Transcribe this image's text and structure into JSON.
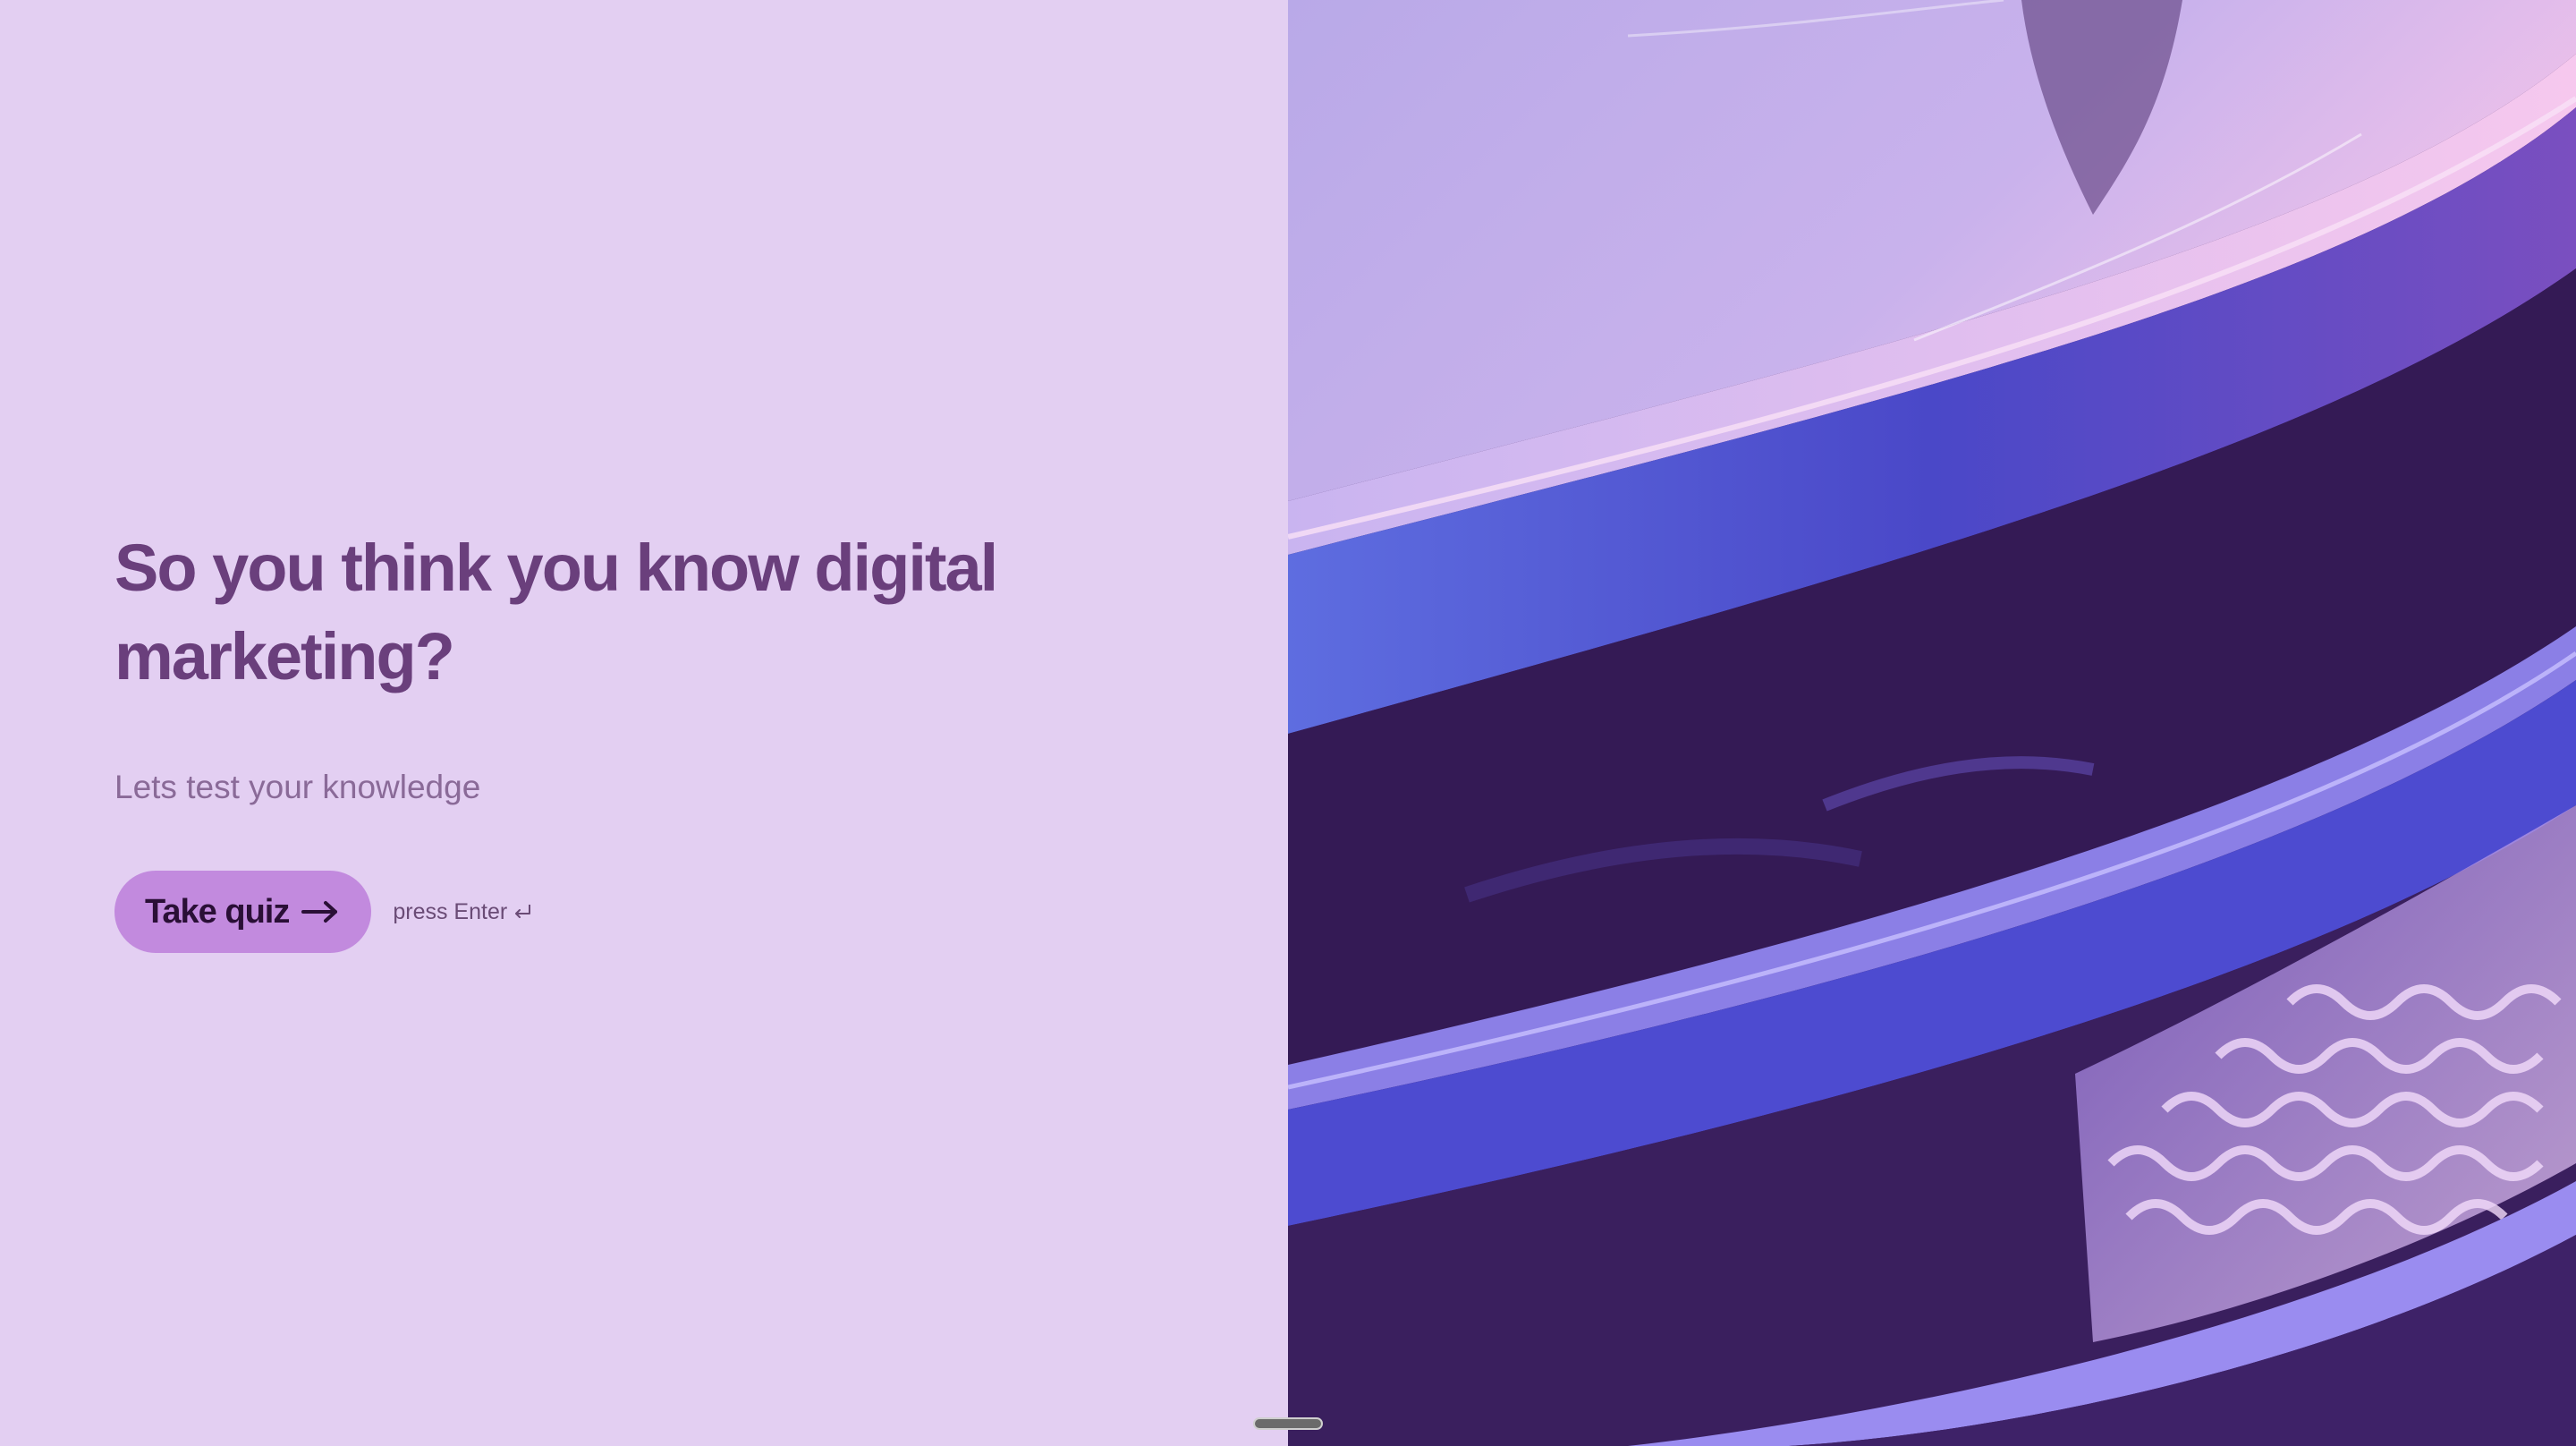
{
  "welcome": {
    "title": "So you think you know digital marketing?",
    "subtitle": "Lets test your knowledge",
    "start_button_label": "Take quiz",
    "start_button_icon": "arrow-right-icon",
    "keyboard_hint": "press Enter",
    "keyboard_hint_icon": "enter-key-icon"
  },
  "cover_image": {
    "description_icon": "abstract-glossy-purple-ribbons-image"
  },
  "colors": {
    "background": "#e3cff2",
    "title": "#6a3f7c",
    "subtitle": "#8a6a98",
    "button": "#c28ade",
    "button_text": "#2a0f36"
  }
}
